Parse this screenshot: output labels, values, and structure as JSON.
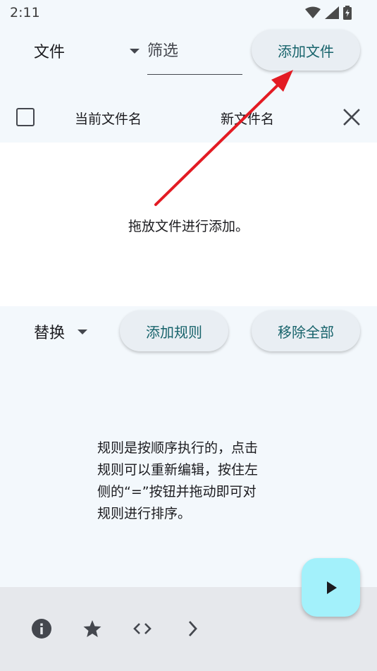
{
  "status_bar": {
    "time": "2:11"
  },
  "toolbar": {
    "file_type_label": "文件",
    "filter_placeholder": "筛选",
    "filter_value": "",
    "add_file_label": "添加文件"
  },
  "file_list": {
    "col_current": "当前文件名",
    "col_new": "新文件名",
    "empty_hint": "拖放文件进行添加。"
  },
  "rules": {
    "rule_type_label": "替换",
    "add_rule_label": "添加规则",
    "remove_all_label": "移除全部",
    "hint_lines": [
      "规则是按顺序执行的，点击",
      "规则可以重新编辑，按住左",
      "侧的“=”按钮并拖动即可对",
      "规则进行排序。"
    ]
  },
  "bottom_nav": {
    "icons": [
      "info-icon",
      "star-icon",
      "code-icon",
      "chevron-right-icon"
    ]
  },
  "fab": {
    "icon": "play-icon"
  },
  "colors": {
    "background": "#f3f8fc",
    "file_area": "#ffffff",
    "button_bg": "#e9eef3",
    "button_text": "#17636b",
    "bottom_bar": "#e6e8ec",
    "fab": "#a3f1fb",
    "annotation_arrow": "#e31b23"
  }
}
